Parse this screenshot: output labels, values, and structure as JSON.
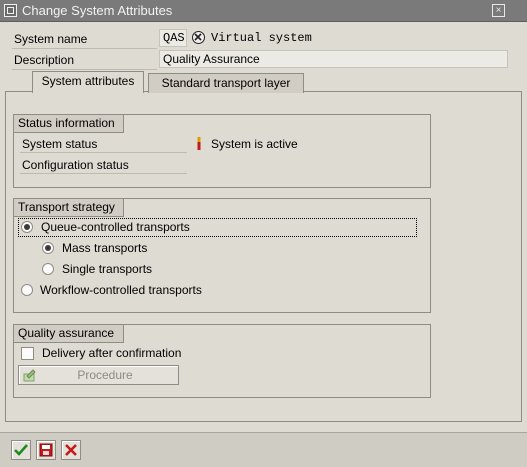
{
  "window": {
    "title": "Change System Attributes",
    "close_glyph": "×"
  },
  "header": {
    "system_name_label": "System name",
    "system_name_value": "QAS",
    "virtual_label": "Virtual system",
    "description_label": "Description",
    "description_value": "Quality Assurance"
  },
  "tabs": [
    {
      "label": "System attributes",
      "active": true
    },
    {
      "label": "Standard transport layer",
      "active": false
    }
  ],
  "status_group": {
    "title": "Status information",
    "system_status_label": "System status",
    "system_status_value": "System is active",
    "configuration_status_label": "Configuration status"
  },
  "strategy_group": {
    "title": "Transport strategy",
    "options": [
      {
        "label": "Queue-controlled transports",
        "selected": true
      },
      {
        "label": "Mass transports",
        "selected": true
      },
      {
        "label": "Single transports",
        "selected": false
      },
      {
        "label": "Workflow-controlled transports",
        "selected": false
      }
    ]
  },
  "qa_group": {
    "title": "Quality assurance",
    "delivery_label": "Delivery after confirmation",
    "delivery_checked": false,
    "procedure_button_label": "Procedure"
  },
  "colors": {
    "titlebar": "#7a7a7a",
    "panel": "#dedbd3",
    "confirm_green": "#1f8a1f",
    "cancel_red": "#c41a1a"
  }
}
